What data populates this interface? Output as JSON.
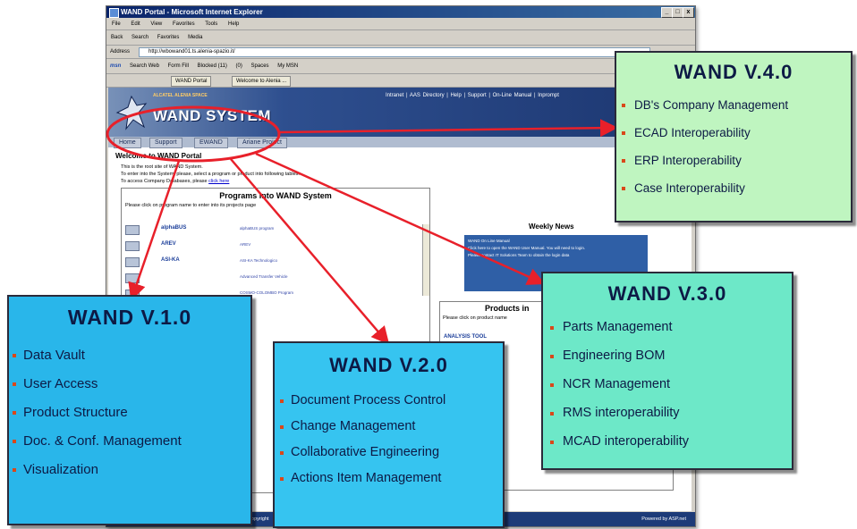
{
  "browser": {
    "title": "WAND Portal - Microsoft Internet Explorer",
    "window_buttons": [
      "_",
      "□",
      "x"
    ],
    "menu": [
      "File",
      "Edit",
      "View",
      "Favorites",
      "Tools",
      "Help"
    ],
    "toolbar": [
      "Back",
      "Search",
      "Favorites",
      "Media"
    ],
    "address_label": "Address",
    "address_value": "http://wbowand01.ts.alenia-spazio.it/",
    "msn_toolbar": [
      "msn",
      "Search Web",
      "Form Fill",
      "Blocked (11)",
      "(0)",
      "Spaces",
      "My MSN"
    ],
    "tabs": [
      "WAND Portal",
      "Welcome to Alenia ..."
    ],
    "status_text": "Copyright",
    "status_right": "Powered by ASP.net"
  },
  "portal": {
    "company": "ALCATEL ALENIA SPACE",
    "system_name": "WAND SYSTEM",
    "top_links": "Intranet  |  AAS Directory  |  Help  |  Support  |  On-Line Manual  |  Inprompt",
    "nav_tabs": [
      "Home",
      "Support",
      "EWAND",
      "Ariane Project"
    ],
    "welcome": "Welcome to WAND Portal",
    "intro_lines": [
      "This is the root site of WAND System.",
      "To enter into the System, please, select a program or product into following tables.",
      "To access Company Databases, please "
    ],
    "intro_link": "click here",
    "programs_title": "Programs into WAND System",
    "programs_hint": "Please click on program name to enter into its projects page",
    "programs": [
      {
        "name": "alphaBUS",
        "desc": "alphaBUS program"
      },
      {
        "name": "AREV",
        "desc": "AREV"
      },
      {
        "name": "ASI-KA",
        "desc": "ASI-KA Technologico"
      },
      {
        "name": "",
        "desc": "Advanced Transfer Vehicle"
      },
      {
        "name": "",
        "desc": "COSMO-COLOMBO Program"
      }
    ],
    "weekly_title": "Weekly News",
    "weekly_lines": [
      "WAND On Line Manual",
      "Click here to open the WAND User Manual. You will need to login.",
      "Please contact IT Solutions Team to obtain the login data"
    ],
    "products_title": "Products in",
    "products_hint": "Please click on product name",
    "products": [
      "ANALYSIS TOOL",
      "",
      "",
      ""
    ]
  },
  "callouts": {
    "v1": {
      "title": "WAND V.1.0",
      "items": [
        "Data Vault",
        "User Access",
        "Product Structure",
        "Doc. & Conf. Management",
        "Visualization"
      ]
    },
    "v2": {
      "title": "WAND V.2.0",
      "items": [
        "Document Process Control",
        "Change Management",
        "Collaborative Engineering",
        "Actions Item Management"
      ]
    },
    "v3": {
      "title": "WAND V.3.0",
      "items": [
        "Parts Management",
        "Engineering BOM",
        "NCR Management",
        "RMS interoperability",
        "MCAD interoperability"
      ]
    },
    "v4": {
      "title": "WAND V.4.0",
      "items": [
        "DB's Company Management",
        "ECAD Interoperability",
        "ERP Interoperability",
        "Case Interoperability"
      ]
    }
  },
  "colors": {
    "v1_bg": "#29b6ea",
    "v2_bg": "#36c4f0",
    "v3_bg": "#6de8c8",
    "v4_bg": "#bff5c0",
    "arrow": "#e8202a",
    "bullet": "#d9481a",
    "banner": "#2e4f8f"
  }
}
